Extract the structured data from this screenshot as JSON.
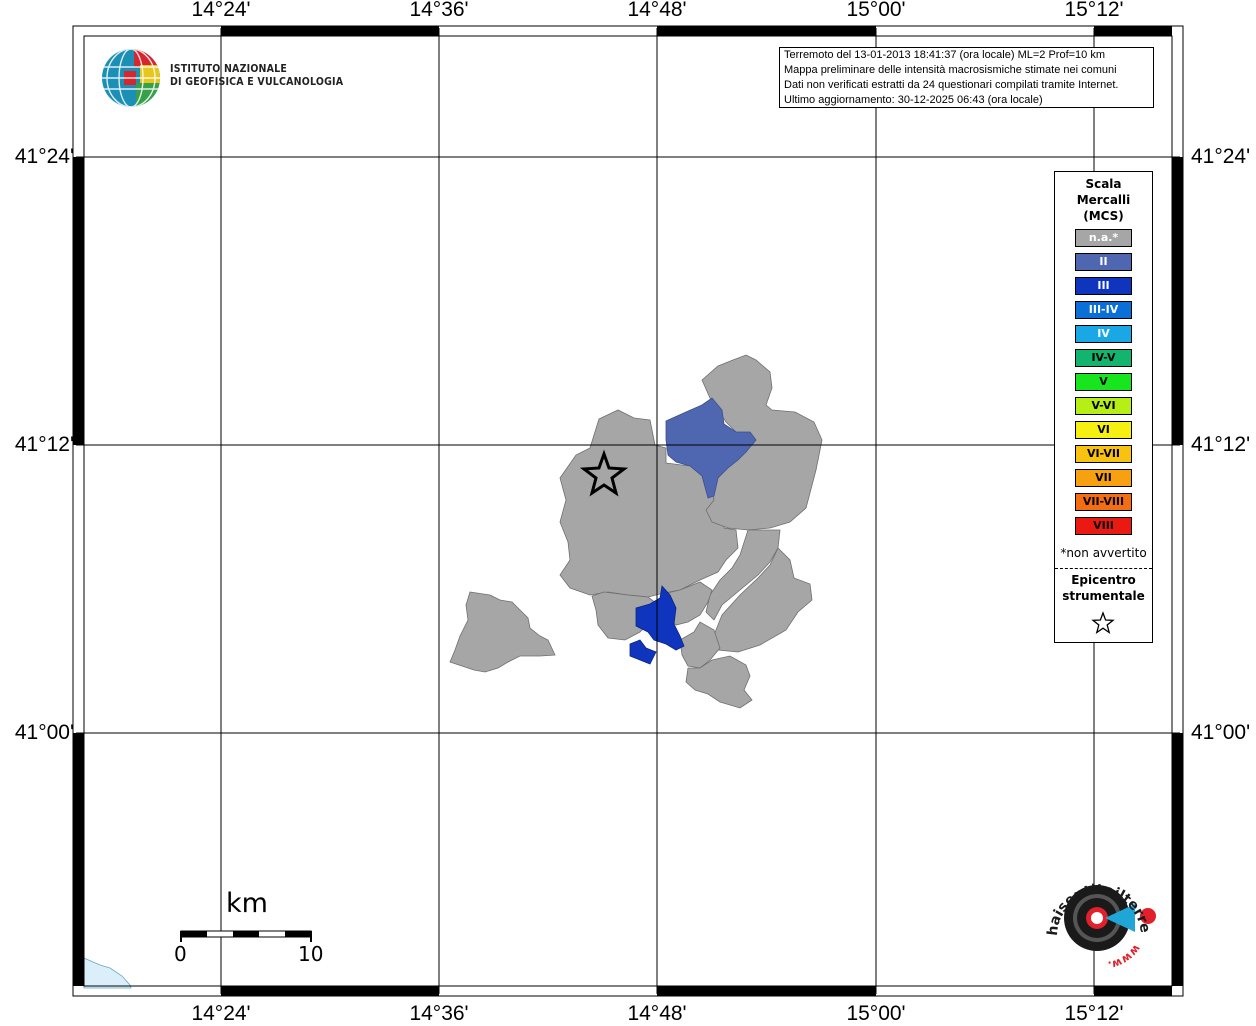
{
  "axes": {
    "lon_labels": [
      "14°24'",
      "14°36'",
      "14°48'",
      "15°00'",
      "15°12'"
    ],
    "lat_labels": [
      "41°24'",
      "41°12'",
      "41°00'"
    ]
  },
  "logo": {
    "line1": "ISTITUTO NAZIONALE",
    "line2": "DI GEOFISICA E VULCANOLOGIA"
  },
  "info": {
    "line1": "Terremoto del 13-01-2013 18:41:37 (ora locale) ML=2 Prof=10 km",
    "line2": "Mappa preliminare delle intensità macrosismiche stimate nei comuni",
    "line3": "Dati non verificati estratti da 24 questionari compilati tramite Internet.",
    "line4": "Ultimo aggiornamento: 30-12-2025 06:43 (ora locale)"
  },
  "legend": {
    "title_line1": "Scala",
    "title_line2": "Mercalli",
    "title_line3": "(MCS)",
    "items": [
      {
        "label": "n.a.*",
        "color": "#a6a6a6",
        "text_color": "#ffffff"
      },
      {
        "label": "II",
        "color": "#4f66b0",
        "text_color": "#ffffff"
      },
      {
        "label": "III",
        "color": "#0f34be",
        "text_color": "#ffffff"
      },
      {
        "label": "III-IV",
        "color": "#0a6fd6",
        "text_color": "#ffffff"
      },
      {
        "label": "IV",
        "color": "#19a7e6",
        "text_color": "#ffffff"
      },
      {
        "label": "IV-V",
        "color": "#13b46e",
        "text_color": "#000000"
      },
      {
        "label": "V",
        "color": "#17e61e",
        "text_color": "#000000"
      },
      {
        "label": "V-VI",
        "color": "#b6ef15",
        "text_color": "#000000"
      },
      {
        "label": "VI",
        "color": "#f5ef12",
        "text_color": "#000000"
      },
      {
        "label": "VI-VII",
        "color": "#f7c310",
        "text_color": "#000000"
      },
      {
        "label": "VII",
        "color": "#f7a010",
        "text_color": "#000000"
      },
      {
        "label": "VII-VIII",
        "color": "#f46d12",
        "text_color": "#000000"
      },
      {
        "label": "VIII",
        "color": "#ea1a12",
        "text_color": "#000000"
      }
    ],
    "note": "*non avvertito",
    "epicenter_line1": "Epicentro",
    "epicenter_line2": "strumentale",
    "epicenter_symbol": "☆"
  },
  "scale": {
    "unit": "km",
    "start": "0",
    "end": "10"
  },
  "hsi_logo": {
    "text": "haisentitoilterremoto.it",
    "www": "www."
  },
  "map": {
    "epicenter_symbol": "star",
    "municipalities": [
      {
        "intensity": "n.a.*"
      },
      {
        "intensity": "II"
      },
      {
        "intensity": "III"
      }
    ]
  }
}
